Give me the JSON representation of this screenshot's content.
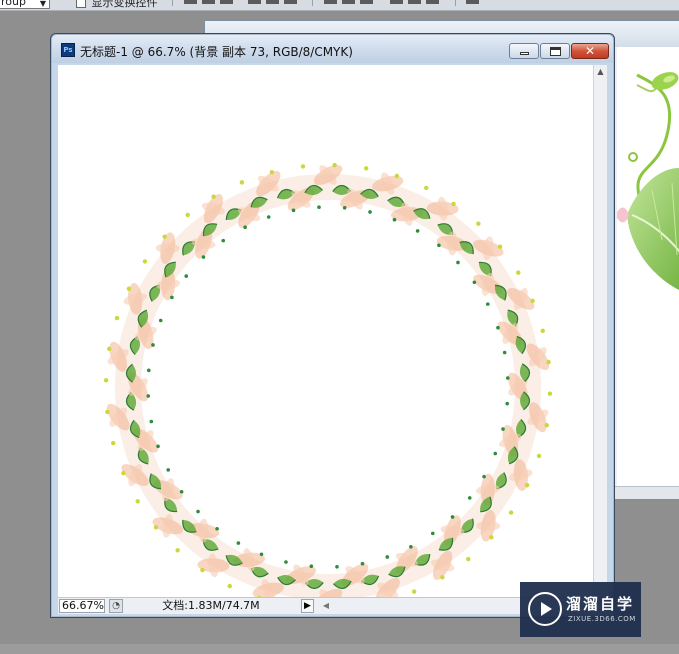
{
  "options_bar": {
    "dropdown_value": "roup",
    "checkbox_label": "显示变换控件"
  },
  "document": {
    "title": "无标题-1 @ 66.7% (背景 副本 73, RGB/8/CMYK)",
    "icon_label": "Ps",
    "close_label": "✕",
    "status": {
      "zoom": "66.67%",
      "doc_info": "文档:1.83M/74.7M",
      "arrow_label": "▶",
      "scroll_left_label": "◀",
      "scroll_up_label": "▲"
    }
  },
  "watermark": {
    "title": "溜溜自学",
    "subtitle": "ZIXUE.3D66.COM"
  },
  "colors": {
    "canvas": "#ffffff",
    "workspace": "#8f8f8f",
    "leaf_green": "#5aa832",
    "petal_peach": "#f2b48f",
    "close_red": "#c23a20"
  },
  "icons": [
    "photoshop-icon",
    "minimize-icon",
    "maximize-icon",
    "close-icon",
    "play-icon"
  ]
}
